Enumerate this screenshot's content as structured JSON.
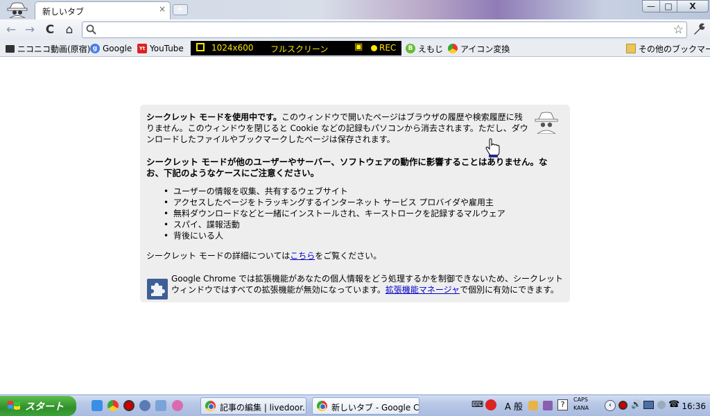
{
  "window": {
    "tab_title": "新しいタブ",
    "tab_close": "×",
    "new_tab": "+",
    "minimize": "—",
    "maximize": "□",
    "close": "X"
  },
  "toolbar": {
    "back": "←",
    "forward": "→",
    "reload": "C",
    "home": "⌂",
    "omnibox_value": "",
    "star": "☆",
    "wrench": "🔧"
  },
  "bookmarks": {
    "items": [
      {
        "label": "ニコニコ動画(原宿)",
        "icon": "nicovideo-icon"
      },
      {
        "label": "Google",
        "icon": "google-icon"
      },
      {
        "label": "YouTube",
        "icon": "youtube-icon"
      },
      {
        "label": "えもじ",
        "icon": "emoji-icon"
      },
      {
        "label": "アイコン変換",
        "icon": "icon-convert-icon"
      }
    ],
    "other": "その他のブックマーク"
  },
  "recorder": {
    "resolution": "1024x600",
    "mode": "フルスクリーン",
    "rec": "REC"
  },
  "incognito": {
    "p1_bold": "シークレット モードを使用中です。",
    "p1_text": "このウィンドウで開いたページはブラウザの履歴や検索履歴に残りません。このウィンドウを閉じると Cookie などの記録もパソコンから消去されます。ただし、ダウンロードしたファイルやブックマークしたページは保存されます。",
    "p2": "シークレット モードが他のユーザーやサーバー、ソフトウェアの動作に影響することはありません。なお、下記のようなケースにご注意ください。",
    "bullets": [
      "ユーザーの情報を収集、共有するウェブサイト",
      "アクセスしたページをトラッキングするインターネット サービス プロバイダや雇用主",
      "無料ダウンロードなどと一緒にインストールされ、キーストロークを記録するマルウェア",
      "スパイ、諜報活動",
      "背後にいる人"
    ],
    "p3_before": "シークレット モードの詳細については",
    "p3_link": "こちら",
    "p3_after": "をご覧ください。",
    "p4_text": "Google Chrome では拡張機能があなたの個人情報をどう処理するかを制御できないため、シークレット ウィンドウではすべての拡張機能が無効になっています。",
    "p4_link": "拡張機能マネージャ",
    "p4_after": "で個別に有効にできます。"
  },
  "taskbar": {
    "start": "スタート",
    "tasks": [
      {
        "label": "記事の編集 | livedoor..."
      },
      {
        "label": "新しいタブ - Google C..."
      }
    ],
    "ime": "A 般",
    "caps": "CAPS",
    "kana": "KANA",
    "clock": "16:36"
  }
}
